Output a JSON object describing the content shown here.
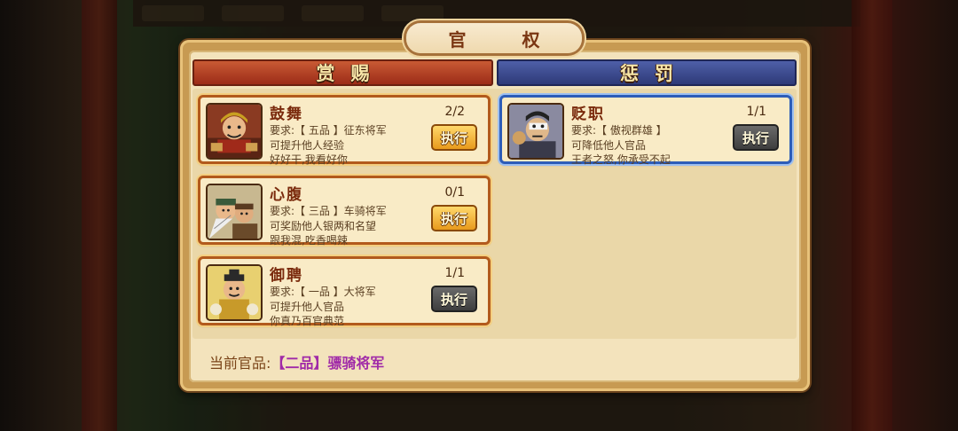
{
  "title": "官 权",
  "tabs": {
    "reward": "赏赐",
    "punish": "惩罚"
  },
  "reward_cards": [
    {
      "name": "鼓舞",
      "requirement": "要求:【 五品 】征东将军",
      "effect": "可提升他人经验",
      "quote": "好好干,我看好你",
      "count": "2/2",
      "button": "执行",
      "button_state": "enabled"
    },
    {
      "name": "心腹",
      "requirement": "要求:【 三品 】车骑将军",
      "effect": "可奖励他人银两和名望",
      "quote": "跟我混,吃香喝辣",
      "count": "0/1",
      "button": "执行",
      "button_state": "enabled"
    },
    {
      "name": "御聘",
      "requirement": "要求:【 一品 】大将军",
      "effect": "可提升他人官品",
      "quote": "你真乃百官典范",
      "count": "1/1",
      "button": "执行",
      "button_state": "disabled"
    }
  ],
  "punish_cards": [
    {
      "name": "贬职",
      "requirement": "要求:【 傲视群雄 】",
      "effect": "可降低他人官品",
      "quote": "王者之怒,你承受不起",
      "count": "1/1",
      "button": "执行",
      "button_state": "disabled"
    }
  ],
  "current_rank": {
    "label": "当前官品:",
    "value": "【二品】骠骑将军"
  },
  "colors": {
    "reward_tab": "#b23e22",
    "punish_tab": "#3b4a90",
    "rank_purple": "#a02aa8",
    "card_border_orange": "#b25a1c",
    "card_border_blue": "#2d5db8"
  }
}
